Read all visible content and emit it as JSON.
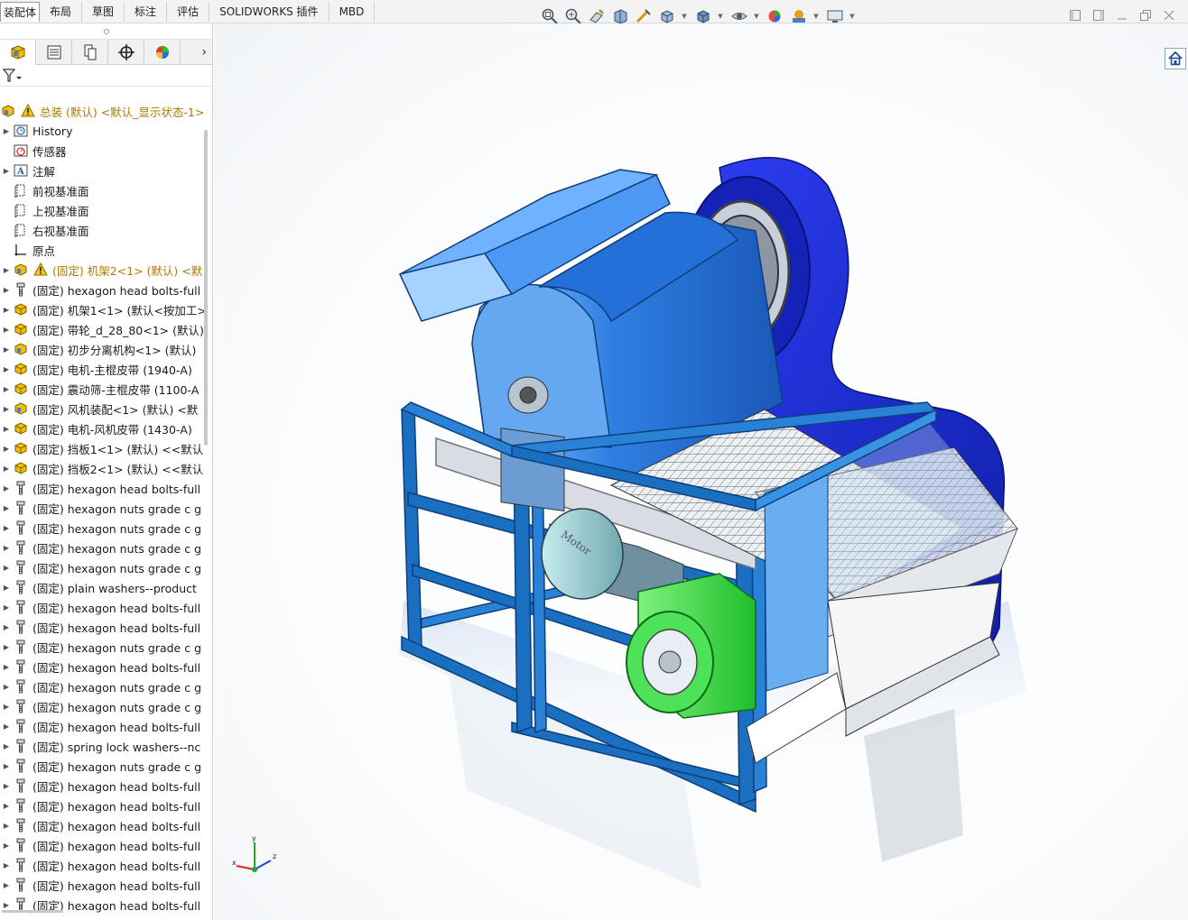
{
  "tabs": [
    "装配体",
    "布局",
    "草图",
    "标注",
    "评估",
    "SOLIDWORKS 插件",
    "MBD"
  ],
  "active_tab": "装配体",
  "hud_icons": [
    "zoom-to-fit-icon",
    "zoom-area-icon",
    "previous-view-icon",
    "section-view-icon",
    "dynamic-annotation-icon",
    "view-orientation-icon",
    "display-style-icon",
    "hide-show-icon",
    "edit-appearance-icon",
    "apply-scene-icon",
    "view-settings-icon"
  ],
  "panel_tabs": [
    "featuremanager-tab",
    "propertymanager-tab",
    "configurationmanager-tab",
    "dimxpert-tab",
    "displaymanager-tab"
  ],
  "tree": {
    "root": "总装 (默认) <默认_显示状态-1>",
    "items": [
      {
        "label": "History",
        "icon": "history-icon",
        "expand": true
      },
      {
        "label": "传感器",
        "icon": "sensor-icon",
        "expand": false
      },
      {
        "label": "注解",
        "icon": "annotation-icon",
        "expand": true
      },
      {
        "label": "前视基准面",
        "icon": "plane-icon",
        "expand": false
      },
      {
        "label": "上视基准面",
        "icon": "plane-icon",
        "expand": false
      },
      {
        "label": "右视基准面",
        "icon": "plane-icon",
        "expand": false
      },
      {
        "label": "原点",
        "icon": "origin-icon",
        "expand": false
      },
      {
        "label": "(固定) 机架2<1> (默认) <默",
        "icon": "assembly-icon",
        "warn": true,
        "expand": true
      },
      {
        "label": "(固定) hexagon head bolts-full",
        "icon": "part-bolt-icon",
        "expand": true
      },
      {
        "label": "(固定) 机架1<1> (默认<按加工>",
        "icon": "part-icon",
        "expand": true
      },
      {
        "label": "(固定) 带轮_d_28_80<1> (默认)",
        "icon": "part-icon",
        "expand": true
      },
      {
        "label": "(固定) 初步分离机构<1> (默认)",
        "icon": "assembly-icon",
        "expand": true
      },
      {
        "label": "(固定) 电机-主棍皮带 (1940-A)",
        "icon": "part-icon",
        "expand": true
      },
      {
        "label": "(固定) 震动筛-主棍皮带 (1100-A",
        "icon": "part-icon",
        "expand": true
      },
      {
        "label": "(固定) 风机装配<1> (默认) <默",
        "icon": "assembly-icon",
        "expand": true
      },
      {
        "label": "(固定) 电机-风机皮带 (1430-A)",
        "icon": "part-icon",
        "expand": true
      },
      {
        "label": "(固定) 挡板1<1> (默认) <<默认",
        "icon": "part-icon",
        "expand": true
      },
      {
        "label": "(固定) 挡板2<1> (默认) <<默认",
        "icon": "part-icon",
        "expand": true
      },
      {
        "label": "(固定) hexagon head bolts-full",
        "icon": "part-bolt-icon",
        "expand": true
      },
      {
        "label": "(固定) hexagon nuts grade c g",
        "icon": "part-bolt-icon",
        "expand": true
      },
      {
        "label": "(固定) hexagon nuts grade c g",
        "icon": "part-bolt-icon",
        "expand": true
      },
      {
        "label": "(固定) hexagon nuts grade c g",
        "icon": "part-bolt-icon",
        "expand": true
      },
      {
        "label": "(固定) hexagon nuts grade c g",
        "icon": "part-bolt-icon",
        "expand": true
      },
      {
        "label": "(固定) plain washers--product",
        "icon": "part-bolt-icon",
        "expand": true
      },
      {
        "label": "(固定) hexagon head bolts-full",
        "icon": "part-bolt-icon",
        "expand": true
      },
      {
        "label": "(固定) hexagon head bolts-full",
        "icon": "part-bolt-icon",
        "expand": true
      },
      {
        "label": "(固定) hexagon nuts grade c g",
        "icon": "part-bolt-icon",
        "expand": true
      },
      {
        "label": "(固定) hexagon head bolts-full",
        "icon": "part-bolt-icon",
        "expand": true
      },
      {
        "label": "(固定) hexagon nuts grade c g",
        "icon": "part-bolt-icon",
        "expand": true
      },
      {
        "label": "(固定) hexagon nuts grade c g",
        "icon": "part-bolt-icon",
        "expand": true
      },
      {
        "label": "(固定) hexagon head bolts-full",
        "icon": "part-bolt-icon",
        "expand": true
      },
      {
        "label": "(固定) spring lock washers--nc",
        "icon": "part-bolt-icon",
        "expand": true
      },
      {
        "label": "(固定) hexagon nuts grade c g",
        "icon": "part-bolt-icon",
        "expand": true
      },
      {
        "label": "(固定) hexagon head bolts-full",
        "icon": "part-bolt-icon",
        "expand": true
      },
      {
        "label": "(固定) hexagon head bolts-full",
        "icon": "part-bolt-icon",
        "expand": true
      },
      {
        "label": "(固定) hexagon head bolts-full",
        "icon": "part-bolt-icon",
        "expand": true
      },
      {
        "label": "(固定) hexagon head bolts-full",
        "icon": "part-bolt-icon",
        "expand": true
      },
      {
        "label": "(固定) hexagon head bolts-full",
        "icon": "part-bolt-icon",
        "expand": true
      },
      {
        "label": "(固定) hexagon head bolts-full",
        "icon": "part-bolt-icon",
        "expand": true
      },
      {
        "label": "(固定) hexagon head bolts-full",
        "icon": "part-bolt-icon",
        "expand": true
      }
    ]
  },
  "triad": {
    "x": "x",
    "y": "y",
    "z": "z"
  },
  "colors": {
    "frame_blue": "#1b6fc0",
    "hood_blue": "#2f7fe3",
    "fan_housing": "#1a2fd6",
    "motor_green": "#3ee24a",
    "motor_grey": "#8fc4c8",
    "warning": "#e6a800"
  }
}
